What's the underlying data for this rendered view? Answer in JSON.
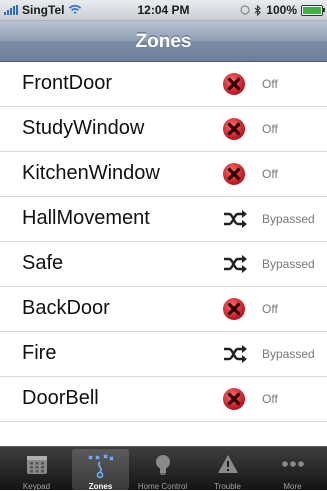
{
  "status_bar": {
    "carrier": "SingTel",
    "time": "12:04 PM",
    "battery": "100%",
    "battery_level": 1.0
  },
  "nav": {
    "title": "Zones"
  },
  "zones": [
    {
      "name": "FrontDoor",
      "status": "Off",
      "icon": "red-x-icon"
    },
    {
      "name": "StudyWindow",
      "status": "Off",
      "icon": "red-x-icon"
    },
    {
      "name": "KitchenWindow",
      "status": "Off",
      "icon": "red-x-icon"
    },
    {
      "name": "HallMovement",
      "status": "Bypassed",
      "icon": "shuffle-icon"
    },
    {
      "name": "Safe",
      "status": "Bypassed",
      "icon": "shuffle-icon"
    },
    {
      "name": "BackDoor",
      "status": "Off",
      "icon": "red-x-icon"
    },
    {
      "name": "Fire",
      "status": "Bypassed",
      "icon": "shuffle-icon"
    },
    {
      "name": "DoorBell",
      "status": "Off",
      "icon": "red-x-icon"
    }
  ],
  "tabs": [
    {
      "label": "Keypad",
      "icon": "keypad-icon",
      "selected": false
    },
    {
      "label": "Zones",
      "icon": "zones-icon",
      "selected": true
    },
    {
      "label": "Home Control",
      "icon": "lightbulb-icon",
      "selected": false
    },
    {
      "label": "Trouble",
      "icon": "warning-icon",
      "selected": false
    },
    {
      "label": "More",
      "icon": "more-icon",
      "selected": false
    }
  ],
  "colors": {
    "off_icon": "#d21f2a",
    "nav_bar": "#8e9db4",
    "tab_bar": "#1a1a1a"
  }
}
